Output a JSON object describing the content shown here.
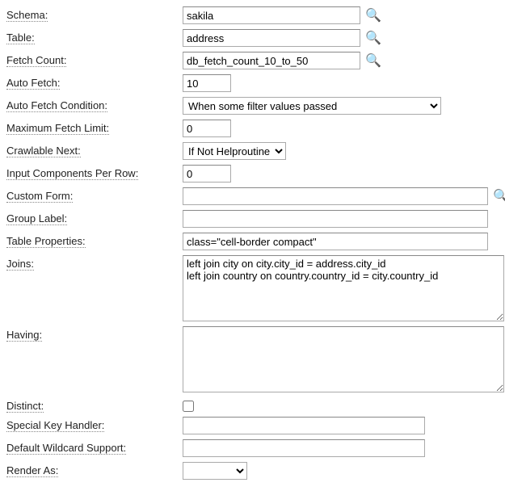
{
  "icons": {
    "search": "🔍"
  },
  "fields": {
    "schema": {
      "label": "Schema:",
      "value": "sakila"
    },
    "table": {
      "label": "Table:",
      "value": "address"
    },
    "fetchCount": {
      "label": "Fetch Count:",
      "value": "db_fetch_count_10_to_50"
    },
    "autoFetch": {
      "label": "Auto Fetch:",
      "value": "10"
    },
    "autoFetchCondition": {
      "label": "Auto Fetch Condition:",
      "selected": "When some filter values passed"
    },
    "maxFetchLimit": {
      "label": "Maximum Fetch Limit:",
      "value": "0"
    },
    "crawlableNext": {
      "label": "Crawlable Next:",
      "selected": "If Not Helproutine"
    },
    "inputCompsPerRow": {
      "label": "Input Components Per Row:",
      "value": "0"
    },
    "customForm": {
      "label": "Custom Form:",
      "value": ""
    },
    "groupLabel": {
      "label": "Group Label:",
      "value": ""
    },
    "tableProperties": {
      "label": "Table Properties:",
      "value": "class=\"cell-border compact\""
    },
    "joins": {
      "label": "Joins:",
      "value": "left join city on city.city_id = address.city_id\nleft join country on country.country_id = city.country_id"
    },
    "having": {
      "label": "Having:",
      "value": ""
    },
    "distinct": {
      "label": "Distinct:",
      "checked": false
    },
    "specialKeyHandler": {
      "label": "Special Key Handler:",
      "value": ""
    },
    "defaultWildcard": {
      "label": "Default Wildcard Support:",
      "value": ""
    },
    "renderAs": {
      "label": "Render As:",
      "selected": ""
    }
  }
}
